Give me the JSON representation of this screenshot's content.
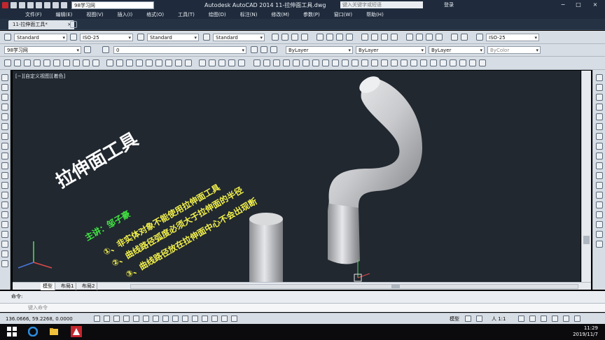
{
  "titlebar": {
    "workspace": "98学习网",
    "title": "Autodesk AutoCAD 2014    11-拉伸面工具.dwg",
    "search_placeholder": "键入关键字或短语",
    "login": "登录",
    "min": "−",
    "max": "□",
    "close": "×"
  },
  "menubar": {
    "items": [
      "文件(F)",
      "编辑(E)",
      "视图(V)",
      "插入(I)",
      "格式(O)",
      "工具(T)",
      "绘图(D)",
      "标注(N)",
      "修改(M)",
      "参数(P)",
      "窗口(W)",
      "帮助(H)"
    ]
  },
  "tabs": {
    "doc_tab": "11-拉伸面工具*",
    "close": "×"
  },
  "styles_toolbar": {
    "text_style": "Standard",
    "dim_style": "ISO-25",
    "table_style": "Standard",
    "multileader_style": "Standard",
    "dim_style_right": "ISO-25"
  },
  "layers_toolbar": {
    "workspace": "98学习网",
    "layer": "0",
    "color": "ByLayer",
    "linetype": "ByLayer",
    "lineweight": "ByLayer",
    "plotstyle": "ByColor"
  },
  "viewport": {
    "label": "[−][自定义视图][着色]"
  },
  "overlay": {
    "title": "拉伸面工具",
    "author": "主讲：邹子豪",
    "note1": "①、非实体对象不能使用拉伸面工具",
    "note2": "②、曲线路径弧度必须大于拉伸面的半径",
    "note3": "③、曲线路径放在拉伸面中心不会出现断"
  },
  "layout_tabs": [
    "模型",
    "布局1",
    "布局2"
  ],
  "command": {
    "history_label": "命令:",
    "prompt_placeholder": "键入命令"
  },
  "statusbar": {
    "coords": "136.0666, 59.2268, 0.0000",
    "model": "模型",
    "scale": "人 1:1"
  },
  "taskbar": {
    "time": "11:29",
    "date": "2019/11/7"
  },
  "colors": {
    "canvas": "#212830",
    "overlay_yellow": "#f2f04b",
    "overlay_green": "#41e341",
    "autocad_red": "#c4262e"
  }
}
